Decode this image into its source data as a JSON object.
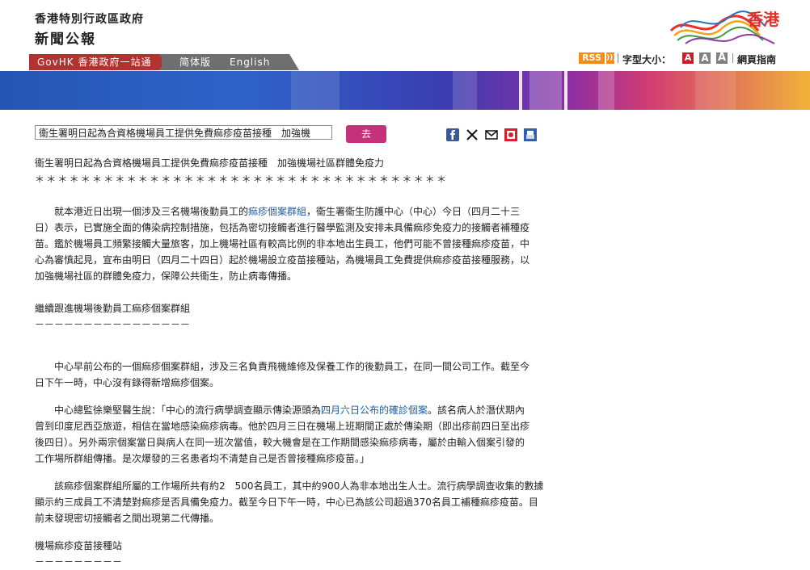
{
  "header": {
    "gov_name": "香港特別行政區政府",
    "section": "新聞公報",
    "logo_text": "香港"
  },
  "nav": {
    "govhk": "GovHK 香港政府一站通",
    "simplified": "简体版",
    "english": "English"
  },
  "tools": {
    "rss": "RSS",
    "font_size_label": "字型大小：",
    "font_a": "A",
    "guide": "網頁指南"
  },
  "search": {
    "value": "衞生署明日起為合資格機場員工提供免費痲疹疫苗接種　加強機",
    "go_label": "去"
  },
  "share": {
    "icons": [
      "facebook-icon",
      "x-icon",
      "email-icon",
      "weibo-icon",
      "print-icon"
    ]
  },
  "article": {
    "title": "衞生署明日起為合資格機場員工提供免費痲疹疫苗接種　加強機場社區群體免疫力",
    "stars": "＊＊＊＊＊＊＊＊＊＊＊＊＊＊＊＊＊＊＊＊＊＊＊＊＊＊＊＊＊＊＊＊＊＊＊＊",
    "p1": {
      "l1_a": "　　就本港近日出現一個涉及三名機場後勤員工的",
      "l1_link": "痲疹個案群組",
      "l1_b": "，衞生署衞生防護中心（中心）今日（四月二十三",
      "l2": "日）表示，已實施全面的傳染病控制措施，包括為密切接觸者進行醫學監測及安排未具備痲疹免疫力的接觸者補種疫",
      "l3": "苗。鑑於機場員工頻繁接觸大量旅客，加上機場社區有較高比例的非本地出生員工，他們可能不曾接種痲疹疫苗，中",
      "l4": "心為審慎起見，宣布由明日（四月二十四日）起於機場設立疫苗接種站，為機場員工免費提供痲疹疫苗接種服務，以",
      "l5": "加強機場社區的群體免疫力，保障公共衞生，防止病毒傳播。"
    },
    "h2": "繼續跟進機場後勤員工痲疹個案群組",
    "h2_dash": "－－－－－－－－－－－－－－－－",
    "p2": {
      "l1": "　　中心早前公布的一個痲疹個案群組，涉及三名負責飛機維修及保養工作的後勤員工，在同一間公司工作。截至今",
      "l2": "日下午一時，中心沒有錄得新增痲疹個案。"
    },
    "p3": {
      "l1_a": "　　中心總監徐樂堅醫生說：「中心的流行病學調查顯示傳染源頭為",
      "l1_link": "四月六日公布的確診個案",
      "l1_b": "。該名病人於潛伏期內",
      "l2": "曾到印度尼西亞旅遊，相信在當地感染痲疹病毒。他於四月三日在機場上班期間正處於傳染期（即出疹前四日至出疹",
      "l3": "後四日）。另外兩宗個案當日與病人在同一班次當值，較大機會是在工作期間感染痲疹病毒，屬於由輸入個案引發的",
      "l4": "工作場所群組傳播。是次爆發的三名患者均不清楚自己是否曾接種痲疹疫苗。」"
    },
    "p4": {
      "l1": "　　該痲疹個案群組所屬的工作場所共有約2　500名員工，其中約900人為非本地出生人士。流行病學調查收集的數據",
      "l2": "顯示約三成員工不清楚對痲疹是否具備免疫力。截至今日下午一時，中心已為該公司超過370名員工補種痲疹疫苗。目",
      "l3": "前未發現密切接觸者之間出現第二代傳播。"
    },
    "h3": "機場痲疹疫苗接種站",
    "h3_dash": "－－－－－－－－－"
  },
  "colors": {
    "nav_red": "#b1332f",
    "nav_grey": "#6f6f6f",
    "go_button": "#c4327a",
    "link": "#1c5fa5",
    "rss": "#f28c1b"
  }
}
